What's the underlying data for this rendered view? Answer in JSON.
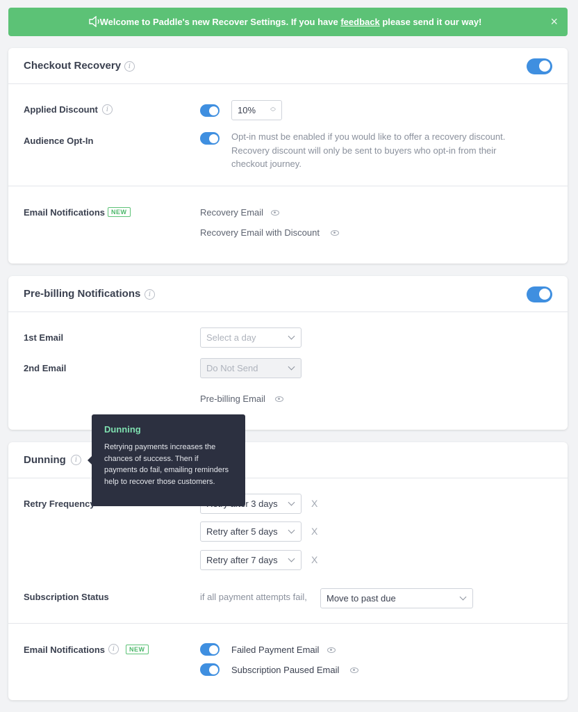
{
  "banner": {
    "text_before": "Welcome to Paddle's new Recover Settings. If you have ",
    "link": "feedback",
    "text_after": " please send it our way!",
    "close": "×"
  },
  "checkout": {
    "title": "Checkout Recovery",
    "enabled": true,
    "applied_discount_label": "Applied Discount",
    "discount_value": "10%",
    "audience_optin_label": "Audience Opt-In",
    "optin_desc": "Opt-in must be enabled if you would like to offer a recovery discount. Recovery discount will only be sent to buyers who opt-in from their checkout journey.",
    "email_notifications_label": "Email Notifications",
    "new_badge": "NEW",
    "recovery_email": "Recovery Email",
    "recovery_email_discount": "Recovery Email with Discount"
  },
  "prebilling": {
    "title": "Pre-billing Notifications",
    "enabled": true,
    "first_email_label": "1st Email",
    "first_email_placeholder": "Select a day",
    "second_email_label": "2nd Email",
    "second_email_value": "Do Not Send",
    "prebilling_email": "Pre-billing Email"
  },
  "dunning": {
    "title": "Dunning",
    "retry_label": "Retry Frequency",
    "retries": [
      "Retry after 3 days",
      "Retry after 5 days",
      "Retry after 7 days"
    ],
    "retry_visible_first": "after 3 days",
    "remove": "X",
    "subscription_status_label": "Subscription Status",
    "if_fail_text": "if all payment attempts fail,",
    "status_value": "Move to past due",
    "email_notifications_label": "Email Notifications",
    "new_badge": "NEW",
    "failed_payment_email": "Failed Payment Email",
    "subscription_paused_email": "Subscription Paused Email"
  },
  "tooltip": {
    "title": "Dunning",
    "body": "Retrying payments increases the chances of success. Then if payments do fail, emailing reminders help to recover those customers."
  },
  "colors": {
    "banner": "#5cc276",
    "toggle_on": "#3f8fe0",
    "tooltip_bg": "#2c3040",
    "tooltip_title": "#7fe0b0"
  },
  "icons": [
    "speaker-icon",
    "close-icon",
    "info-icon",
    "eye-icon",
    "chevron-down-icon",
    "stepper-icon",
    "remove-icon"
  ]
}
